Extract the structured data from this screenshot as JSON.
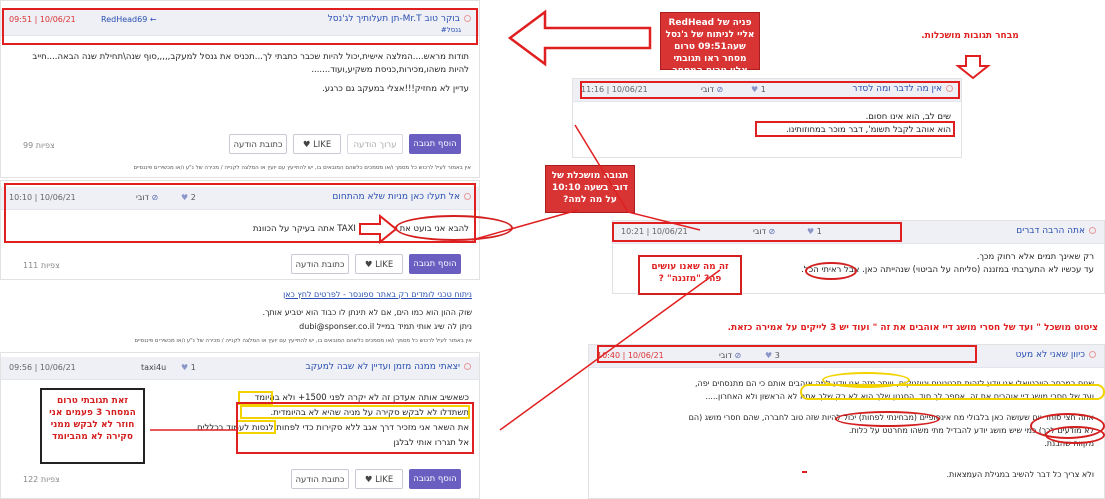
{
  "posts": {
    "p1": {
      "title": "בוקר טוב Mr.T-תן תעלותיך לג'נסל",
      "date": "09:51 | 10/06/21",
      "user": "RedHead69 ←",
      "tag": "#גנסל",
      "body1": "תודות מראש....המלצה אישית,יכול להיות שכבר כתבתי לך...תכניס את גנסל למעקב,,,,,סוף שנה\\תחילת שנה הבאה....חייב",
      "body2": "להיות משהו,מכירות,כניסת משקיע,ועוד.......",
      "body3": "עדיין לא מחזיק!!!אצלי במעקב גם כרגע.",
      "reply": "הוסף תגובה",
      "edit": "ערוך הודעה",
      "like": "LIKE",
      "quote": "כתובת הודעה",
      "views": "99 צפיות",
      "disclaimer": "אין באמור לעיל לרכוש כל מסמך ו/או מסמכים כלשהם המובאים בו, יש להתייעץ עם יועץ או המלצה לקנייה / מכירה של נ\"ע ו/או מכשירים פיננסיים"
    },
    "p2": {
      "title": "אל תעלו כאן מניות שלא מהתחום",
      "date": "10:10 | 10/06/21",
      "user": "דובי",
      "likes": "2",
      "body": "להבא אני בועט את כולם מכאן TAXI אתה בעיקר על הכוונת",
      "reply": "הוסף תגובה",
      "like": "LIKE",
      "quote": "כתובת הודעה",
      "views": "111 צפיות"
    },
    "sponsor": {
      "link": "ניתוח טכני לומדים רק באתר ספונסר - לפרטים לחץ כאן",
      "line1": "שוק ההון הוא כמו הים, אם לא תינתן לו כבוד הוא יטביע אותך.",
      "line2": "ניתן לה שיג אותי תמיד במייל dubi@sponser.co.il",
      "disclaimer": "אין באמור לעיל לרכוש כל מסמך ו/או מסמכים כלשהם המובאים בו, יש להתייעץ עם יועץ או המלצה לקנייה / מכירה של נ\"ע ו/או מכשירים פיננסיים"
    },
    "p3": {
      "title": "יצאתי ממנה מזמן ועדיין לא שבה למעקב",
      "date": "09:56 | 10/06/21",
      "user": "taxi4u",
      "likes": "1",
      "l1": "כשאשיב אותה אעדכן זה לא יקרה לפני 1500+ ולא בהיומד",
      "l2": "תשתדלו לא לבקש סקירה על מניה שהיא לא בהיומדית.",
      "l3": "את השאר אני מזכיר דרך אגב ללא סקירות כדי לפחות לנסות לעמוד בכללים",
      "l4": "אל תגררו אותי לבלגן",
      "reply": "הוסף תגובה",
      "like": "LIKE",
      "quote": "כתובת הודעה",
      "views": "122 צפיות"
    },
    "r1": {
      "title": "אין מה לדבר ומה לסדר",
      "date": "11:16 | 10/06/21",
      "user": "דובי",
      "likes": "1",
      "l1": "שים לב, הוא אינו חסום.",
      "l2": "הוא אוהב לקבל תשומ', דבר מוכר במחוזותינו."
    },
    "r2": {
      "title": "אתה הרבה דברים",
      "date": "10:21 | 10/06/21",
      "user": "דובי",
      "likes": "1",
      "l1": "רק שאינך תמים אלא רחוק מכך.",
      "l2": "עד עכשיו לא התערבתי במזננה (סליחה על הביטוי) שנהייתה כאן. אבל ראיתי הכל."
    },
    "r3": {
      "title": "כיוון שאני לא מעט",
      "date": "10:40 | 10/06/21",
      "user": "דובי",
      "likes": "3",
      "l1": "שנים במרחב הוירטואלי אני יודע לזהות תרטטנים וטוזניקים, ויותר מזה אני יודע למה אוהבים אותם כי הם מתנסחים יפה,",
      "l2": "ועד של חסרי מושג דיי אוהבים את זה. אספר לך סוד, הסגנון שלך הוא לא רק שלך אתה לא הראשון ולא האחרון.....",
      "l3": "אתה חצי סוחר יום שעושה כאן בלבולי מח אינסופיים (מבחינתי לפחות) יכול להיות שזה טוב לחברה, שהם חסרי מושג (הם",
      "l4": "לא מודעים לכך) כמי שיש מושג יודע להבדיל מתי משהו מחרטט על כלות.",
      "l5": "מקווה שהבנת.",
      "l6": "ולא צריך כל דבר להשיב במגילת העמצאות."
    }
  },
  "annotations": {
    "callout_redhead": "פניה של RedHead אליי לניתוח של ג'נסל שעה09:51 טרום מסחר ראו תגובתי אליו טרום המסחר",
    "callout_dubi": "תגובה מושכלת של דובי בשעה 10:10 על מה למה?",
    "callout_taxi": "זאת תגובתי טרום המסחר 3 פעמים אני חוזר לא לבקש ממני סקירה לא מהביומד",
    "note_replies": "מבחר תגובות מושכלות.",
    "note_question": "זה מה שאנו עושים פה? \"מזננה\" ?",
    "note_quote": "ציטוט מושכל \" ועד של חסרי מושג דיי אוהבים את זה \"    ועוד יש 3 לייקים על אמירה כזאת."
  }
}
